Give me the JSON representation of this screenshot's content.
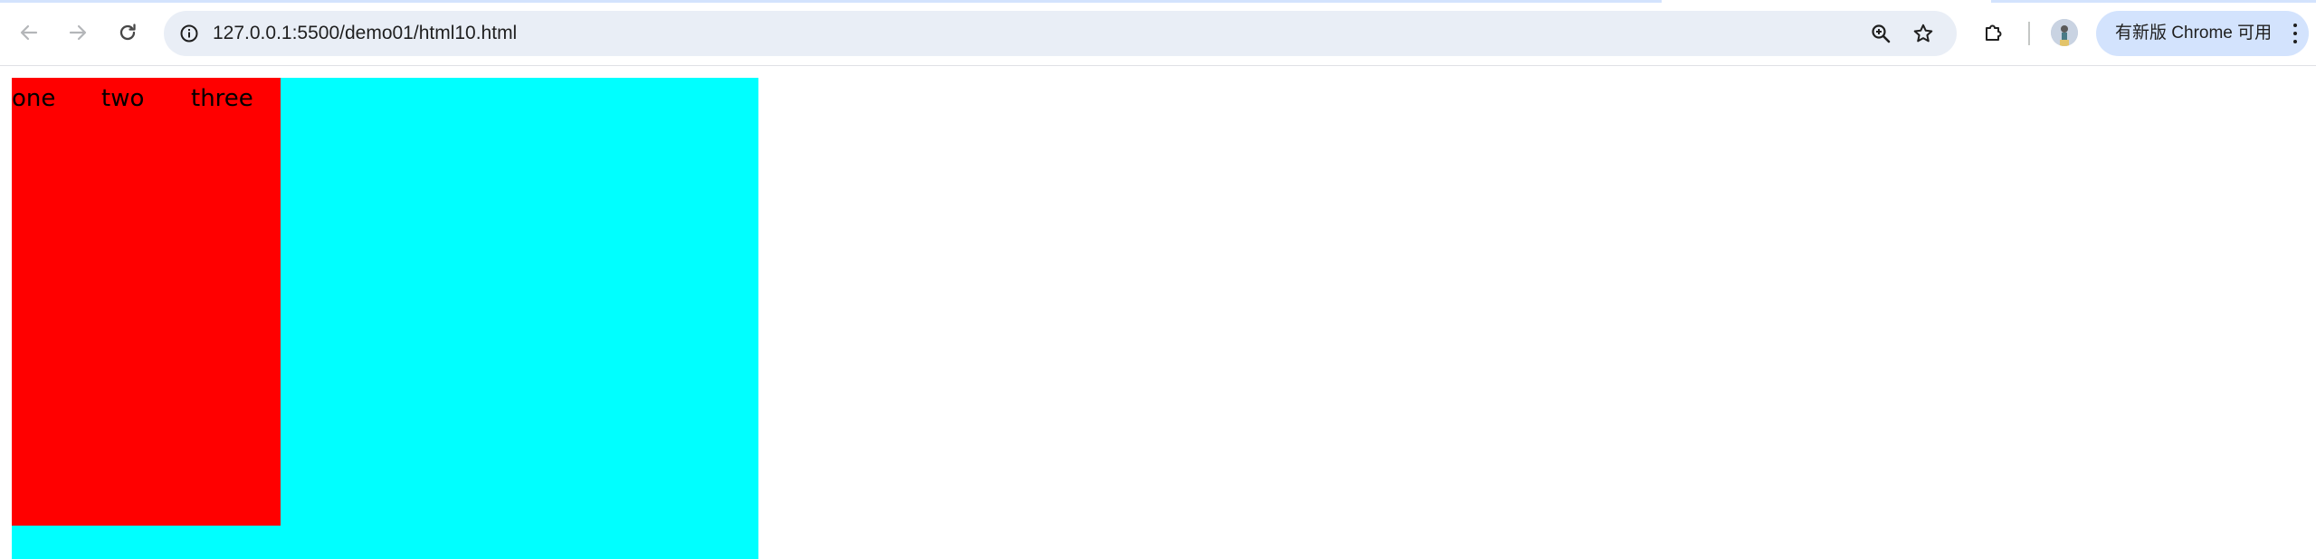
{
  "browser": {
    "url": "127.0.0.1:5500/demo01/html10.html",
    "update_button_label": "有新版 Chrome 可用",
    "icons": {
      "back": "arrow-left-icon",
      "forward": "arrow-right-icon",
      "reload": "reload-icon",
      "site_info": "info-icon",
      "zoom": "zoom-in-icon",
      "bookmark": "star-icon",
      "extensions": "puzzle-icon",
      "profile": "avatar",
      "menu": "kebab-menu-icon"
    }
  },
  "page": {
    "outer_box_color": "#00ffff",
    "inner_box_color": "#ff0000",
    "items": [
      "one",
      "two",
      "three"
    ]
  }
}
